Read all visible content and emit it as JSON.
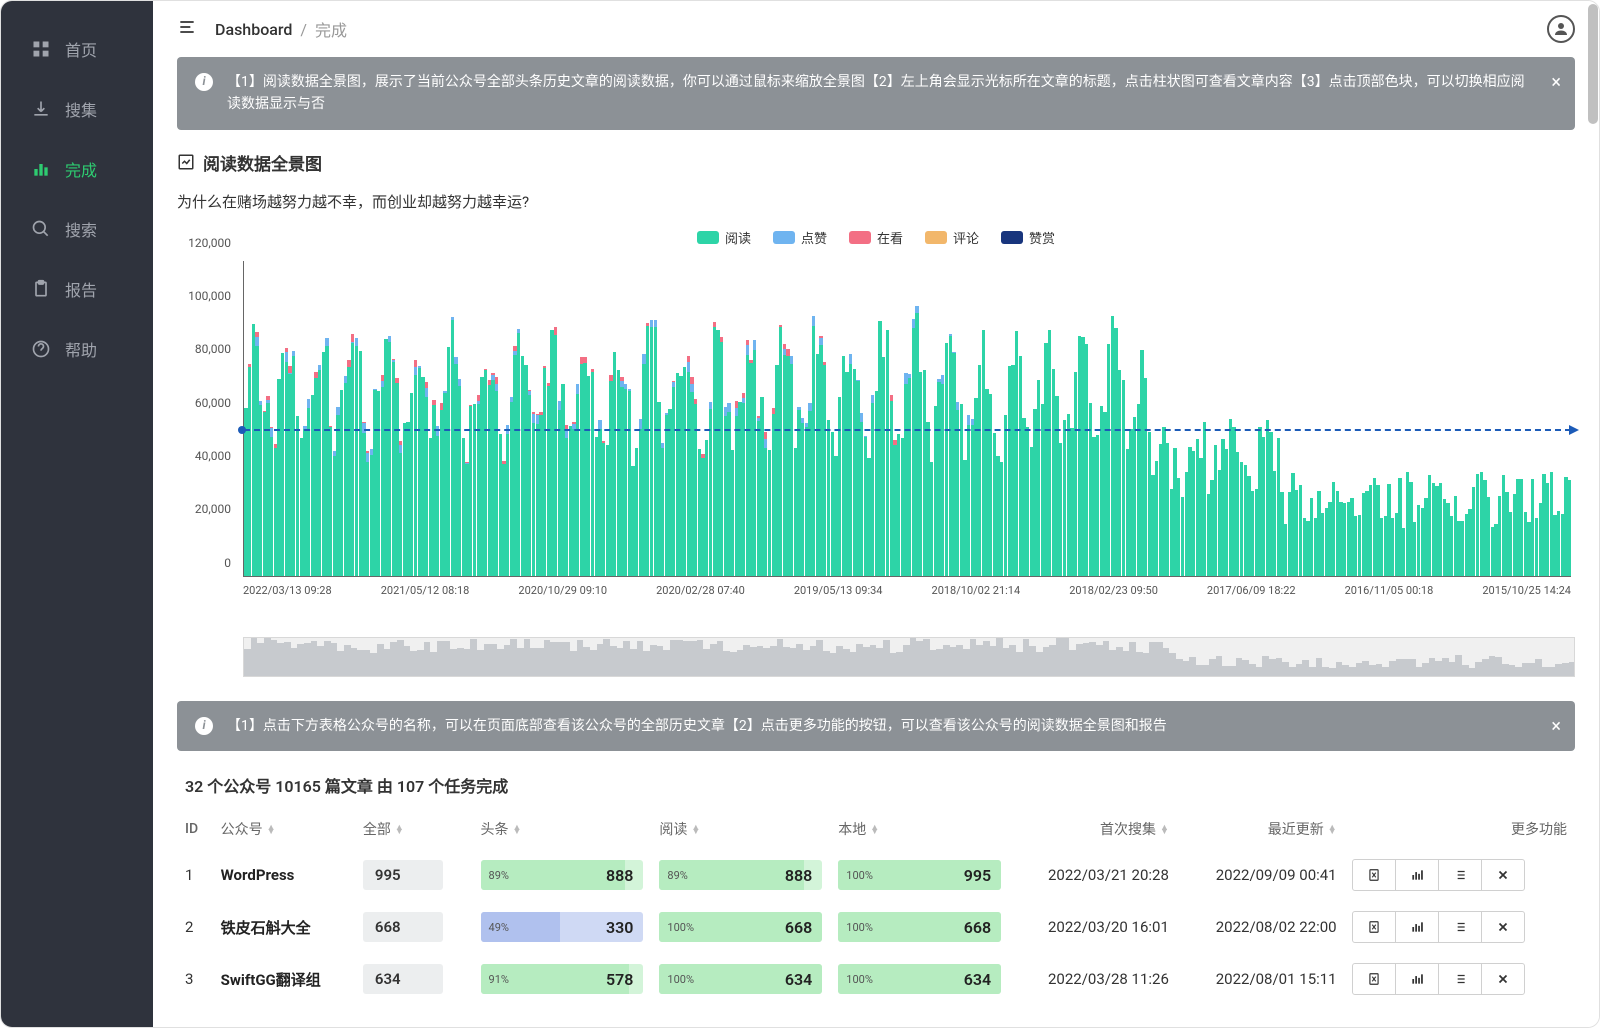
{
  "sidebar": {
    "items": [
      {
        "label": "首页",
        "icon": "grid"
      },
      {
        "label": "搜集",
        "icon": "download"
      },
      {
        "label": "完成",
        "icon": "bars",
        "active": true
      },
      {
        "label": "搜索",
        "icon": "search"
      },
      {
        "label": "报告",
        "icon": "clipboard"
      },
      {
        "label": "帮助",
        "icon": "help"
      }
    ]
  },
  "breadcrumb": {
    "root": "Dashboard",
    "current": "完成"
  },
  "alert1": "【1】阅读数据全景图，展示了当前公众号全部头条历史文章的阅读数据，你可以通过鼠标来缩放全景图【2】左上角会显示光标所在文章的标题，点击柱状图可查看文章内容【3】点击顶部色块，可以切换相应阅读数据显示与否",
  "panel1_title": "阅读数据全景图",
  "hover_title": "为什么在赌场越努力越不幸，而创业却越努力越幸运?",
  "legend": [
    {
      "label": "阅读",
      "color": "#2dd4a7"
    },
    {
      "label": "点赞",
      "color": "#6fb4f0"
    },
    {
      "label": "在看",
      "color": "#f36f84"
    },
    {
      "label": "评论",
      "color": "#f2b76b"
    },
    {
      "label": "赞赏",
      "color": "#18357d"
    }
  ],
  "chart_data": {
    "type": "bar",
    "ylabel": "",
    "ylim": [
      0,
      120000
    ],
    "yticks": [
      0,
      20000,
      40000,
      60000,
      80000,
      100000,
      120000
    ],
    "average_line": 55000,
    "x_labels": [
      "2022/03/13 09:28",
      "2021/05/12 08:18",
      "2020/10/29 09:10",
      "2020/02/28 07:40",
      "2019/05/13 09:34",
      "2018/10/02 21:14",
      "2018/02/23 09:50",
      "2017/06/09 18:22",
      "2016/11/05 00:18",
      "2015/10/25 14:24"
    ],
    "series": [
      {
        "name": "阅读",
        "color": "#2dd4a7"
      },
      {
        "name": "点赞",
        "color": "#6fb4f0"
      },
      {
        "name": "在看",
        "color": "#f36f84"
      },
      {
        "name": "评论",
        "color": "#f2b76b"
      },
      {
        "name": "赞赏",
        "color": "#18357d"
      }
    ],
    "note": "Approx 350+ daily stacked bars; reads dominate (40k-100k range left 2/3, tapering to 10k-40k at right); small blue/pink caps on many left-side bars"
  },
  "alert2": "【1】点击下方表格公众号的名称，可以在页面底部查看该公众号的全部历史文章【2】点击更多功能的按钮，可以查看该公众号的阅读数据全景图和报告",
  "table_title": "32 个公众号 10165 篇文章 由 107 个任务完成",
  "columns": {
    "id": "ID",
    "account": "公众号",
    "all": "全部",
    "headline": "头条",
    "read": "阅读",
    "local": "本地",
    "first_collect": "首次搜集",
    "last_update": "最近更新",
    "more": "更多功能"
  },
  "rows": [
    {
      "id": "1",
      "name": "WordPress",
      "all": "995",
      "headline_pct": "89%",
      "headline_val": "888",
      "read_pct": "89%",
      "read_val": "888",
      "local_pct": "100%",
      "local_val": "995",
      "first": "2022/03/21 20:28",
      "last": "2022/09/09 00:41",
      "headline_color": "green"
    },
    {
      "id": "2",
      "name": "铁皮石斛大全",
      "all": "668",
      "headline_pct": "49%",
      "headline_val": "330",
      "read_pct": "100%",
      "read_val": "668",
      "local_pct": "100%",
      "local_val": "668",
      "first": "2022/03/20 16:01",
      "last": "2022/08/02 22:00",
      "headline_color": "blue"
    },
    {
      "id": "3",
      "name": "SwiftGG翻译组",
      "all": "634",
      "headline_pct": "91%",
      "headline_val": "578",
      "read_pct": "100%",
      "read_val": "634",
      "local_pct": "100%",
      "local_val": "634",
      "first": "2022/03/28 11:26",
      "last": "2022/08/01 15:11",
      "headline_color": "green"
    }
  ]
}
